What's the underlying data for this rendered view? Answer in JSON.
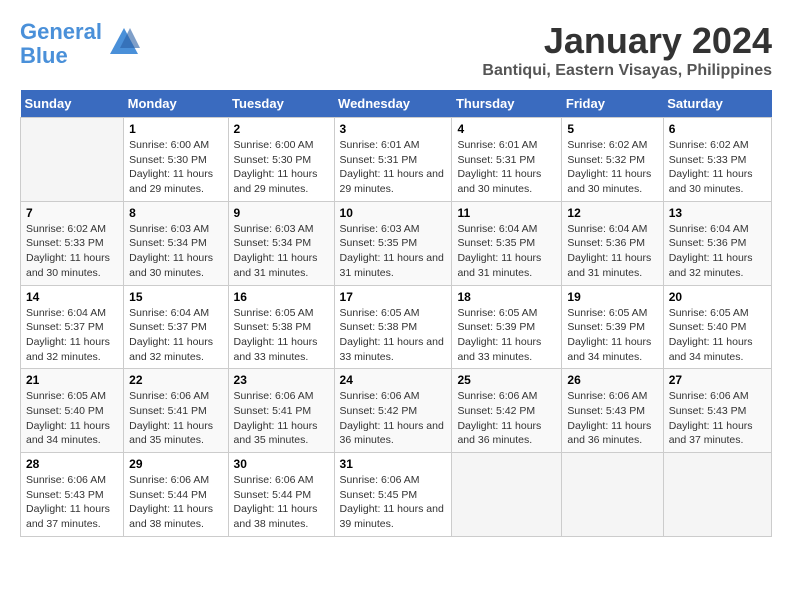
{
  "logo": {
    "line1": "General",
    "line2": "Blue"
  },
  "title": "January 2024",
  "subtitle": "Bantiqui, Eastern Visayas, Philippines",
  "weekdays": [
    "Sunday",
    "Monday",
    "Tuesday",
    "Wednesday",
    "Thursday",
    "Friday",
    "Saturday"
  ],
  "weeks": [
    [
      {
        "day": "",
        "sunrise": "",
        "sunset": "",
        "daylight": ""
      },
      {
        "day": "1",
        "sunrise": "Sunrise: 6:00 AM",
        "sunset": "Sunset: 5:30 PM",
        "daylight": "Daylight: 11 hours and 29 minutes."
      },
      {
        "day": "2",
        "sunrise": "Sunrise: 6:00 AM",
        "sunset": "Sunset: 5:30 PM",
        "daylight": "Daylight: 11 hours and 29 minutes."
      },
      {
        "day": "3",
        "sunrise": "Sunrise: 6:01 AM",
        "sunset": "Sunset: 5:31 PM",
        "daylight": "Daylight: 11 hours and 29 minutes."
      },
      {
        "day": "4",
        "sunrise": "Sunrise: 6:01 AM",
        "sunset": "Sunset: 5:31 PM",
        "daylight": "Daylight: 11 hours and 30 minutes."
      },
      {
        "day": "5",
        "sunrise": "Sunrise: 6:02 AM",
        "sunset": "Sunset: 5:32 PM",
        "daylight": "Daylight: 11 hours and 30 minutes."
      },
      {
        "day": "6",
        "sunrise": "Sunrise: 6:02 AM",
        "sunset": "Sunset: 5:33 PM",
        "daylight": "Daylight: 11 hours and 30 minutes."
      }
    ],
    [
      {
        "day": "7",
        "sunrise": "Sunrise: 6:02 AM",
        "sunset": "Sunset: 5:33 PM",
        "daylight": "Daylight: 11 hours and 30 minutes."
      },
      {
        "day": "8",
        "sunrise": "Sunrise: 6:03 AM",
        "sunset": "Sunset: 5:34 PM",
        "daylight": "Daylight: 11 hours and 30 minutes."
      },
      {
        "day": "9",
        "sunrise": "Sunrise: 6:03 AM",
        "sunset": "Sunset: 5:34 PM",
        "daylight": "Daylight: 11 hours and 31 minutes."
      },
      {
        "day": "10",
        "sunrise": "Sunrise: 6:03 AM",
        "sunset": "Sunset: 5:35 PM",
        "daylight": "Daylight: 11 hours and 31 minutes."
      },
      {
        "day": "11",
        "sunrise": "Sunrise: 6:04 AM",
        "sunset": "Sunset: 5:35 PM",
        "daylight": "Daylight: 11 hours and 31 minutes."
      },
      {
        "day": "12",
        "sunrise": "Sunrise: 6:04 AM",
        "sunset": "Sunset: 5:36 PM",
        "daylight": "Daylight: 11 hours and 31 minutes."
      },
      {
        "day": "13",
        "sunrise": "Sunrise: 6:04 AM",
        "sunset": "Sunset: 5:36 PM",
        "daylight": "Daylight: 11 hours and 32 minutes."
      }
    ],
    [
      {
        "day": "14",
        "sunrise": "Sunrise: 6:04 AM",
        "sunset": "Sunset: 5:37 PM",
        "daylight": "Daylight: 11 hours and 32 minutes."
      },
      {
        "day": "15",
        "sunrise": "Sunrise: 6:04 AM",
        "sunset": "Sunset: 5:37 PM",
        "daylight": "Daylight: 11 hours and 32 minutes."
      },
      {
        "day": "16",
        "sunrise": "Sunrise: 6:05 AM",
        "sunset": "Sunset: 5:38 PM",
        "daylight": "Daylight: 11 hours and 33 minutes."
      },
      {
        "day": "17",
        "sunrise": "Sunrise: 6:05 AM",
        "sunset": "Sunset: 5:38 PM",
        "daylight": "Daylight: 11 hours and 33 minutes."
      },
      {
        "day": "18",
        "sunrise": "Sunrise: 6:05 AM",
        "sunset": "Sunset: 5:39 PM",
        "daylight": "Daylight: 11 hours and 33 minutes."
      },
      {
        "day": "19",
        "sunrise": "Sunrise: 6:05 AM",
        "sunset": "Sunset: 5:39 PM",
        "daylight": "Daylight: 11 hours and 34 minutes."
      },
      {
        "day": "20",
        "sunrise": "Sunrise: 6:05 AM",
        "sunset": "Sunset: 5:40 PM",
        "daylight": "Daylight: 11 hours and 34 minutes."
      }
    ],
    [
      {
        "day": "21",
        "sunrise": "Sunrise: 6:05 AM",
        "sunset": "Sunset: 5:40 PM",
        "daylight": "Daylight: 11 hours and 34 minutes."
      },
      {
        "day": "22",
        "sunrise": "Sunrise: 6:06 AM",
        "sunset": "Sunset: 5:41 PM",
        "daylight": "Daylight: 11 hours and 35 minutes."
      },
      {
        "day": "23",
        "sunrise": "Sunrise: 6:06 AM",
        "sunset": "Sunset: 5:41 PM",
        "daylight": "Daylight: 11 hours and 35 minutes."
      },
      {
        "day": "24",
        "sunrise": "Sunrise: 6:06 AM",
        "sunset": "Sunset: 5:42 PM",
        "daylight": "Daylight: 11 hours and 36 minutes."
      },
      {
        "day": "25",
        "sunrise": "Sunrise: 6:06 AM",
        "sunset": "Sunset: 5:42 PM",
        "daylight": "Daylight: 11 hours and 36 minutes."
      },
      {
        "day": "26",
        "sunrise": "Sunrise: 6:06 AM",
        "sunset": "Sunset: 5:43 PM",
        "daylight": "Daylight: 11 hours and 36 minutes."
      },
      {
        "day": "27",
        "sunrise": "Sunrise: 6:06 AM",
        "sunset": "Sunset: 5:43 PM",
        "daylight": "Daylight: 11 hours and 37 minutes."
      }
    ],
    [
      {
        "day": "28",
        "sunrise": "Sunrise: 6:06 AM",
        "sunset": "Sunset: 5:43 PM",
        "daylight": "Daylight: 11 hours and 37 minutes."
      },
      {
        "day": "29",
        "sunrise": "Sunrise: 6:06 AM",
        "sunset": "Sunset: 5:44 PM",
        "daylight": "Daylight: 11 hours and 38 minutes."
      },
      {
        "day": "30",
        "sunrise": "Sunrise: 6:06 AM",
        "sunset": "Sunset: 5:44 PM",
        "daylight": "Daylight: 11 hours and 38 minutes."
      },
      {
        "day": "31",
        "sunrise": "Sunrise: 6:06 AM",
        "sunset": "Sunset: 5:45 PM",
        "daylight": "Daylight: 11 hours and 39 minutes."
      },
      {
        "day": "",
        "sunrise": "",
        "sunset": "",
        "daylight": ""
      },
      {
        "day": "",
        "sunrise": "",
        "sunset": "",
        "daylight": ""
      },
      {
        "day": "",
        "sunrise": "",
        "sunset": "",
        "daylight": ""
      }
    ]
  ]
}
